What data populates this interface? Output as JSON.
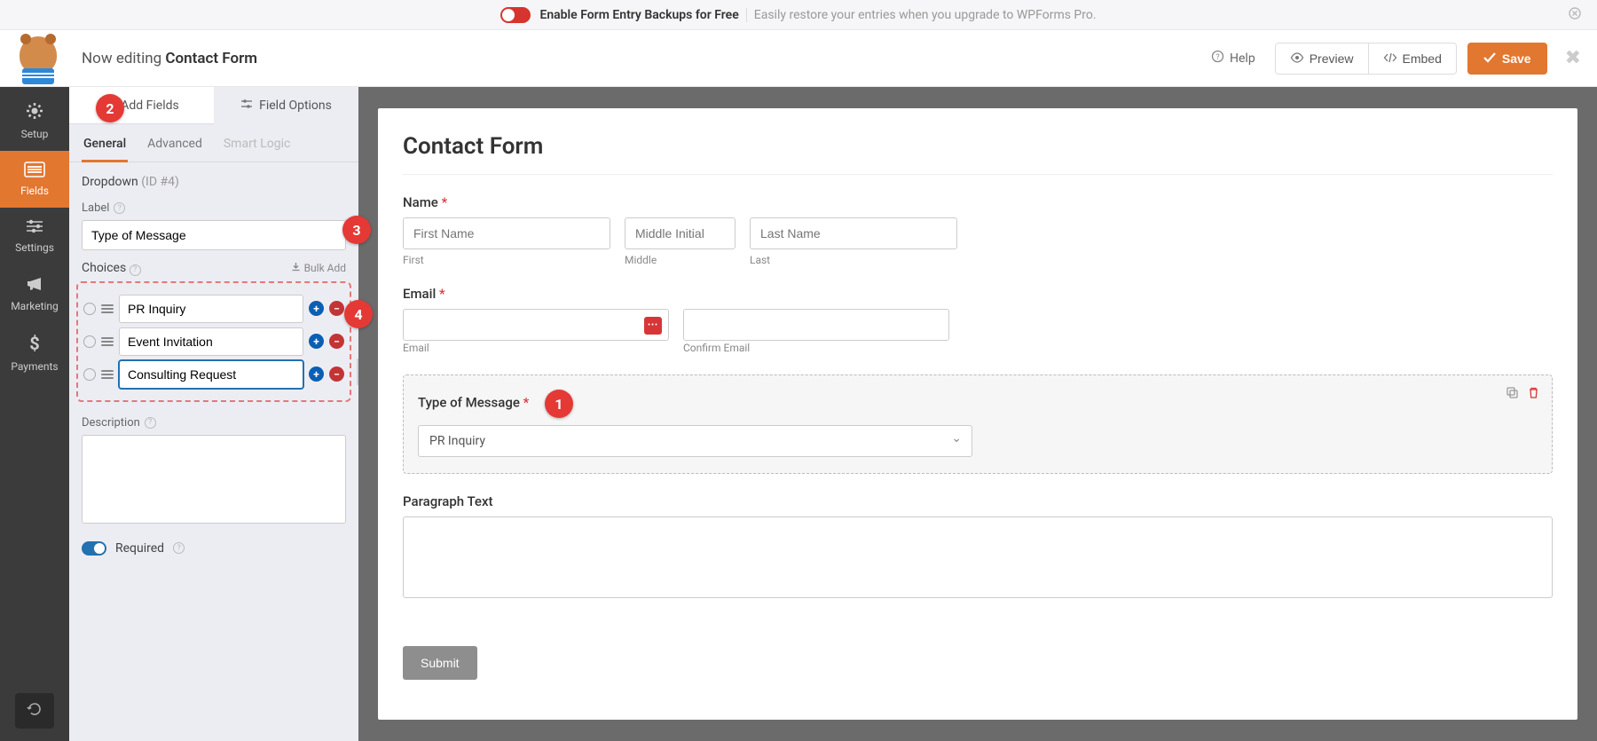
{
  "banner": {
    "bold_text": "Enable Form Entry Backups for Free",
    "light_text": "Easily restore your entries when you upgrade to WPForms Pro."
  },
  "header": {
    "editing_prefix": "Now editing ",
    "form_name": "Contact Form",
    "help": "Help",
    "preview": "Preview",
    "embed": "Embed",
    "save": "Save"
  },
  "nav": {
    "setup": "Setup",
    "fields": "Fields",
    "settings": "Settings",
    "marketing": "Marketing",
    "payments": "Payments"
  },
  "panel": {
    "tab_add": "Add Fields",
    "tab_options": "Field Options",
    "sub_general": "General",
    "sub_advanced": "Advanced",
    "sub_smart": "Smart Logic",
    "field_type": "Dropdown",
    "field_id": "(ID #4)",
    "label_label": "Label",
    "label_value": "Type of Message",
    "choices_label": "Choices",
    "bulk_add": "Bulk Add",
    "choice1": "PR Inquiry",
    "choice2": "Event Invitation",
    "choice3": "Consulting Request",
    "description_label": "Description",
    "required_label": "Required"
  },
  "callouts": {
    "c1": "1",
    "c2": "2",
    "c3": "3",
    "c4": "4"
  },
  "form": {
    "title": "Contact Form",
    "name_label": "Name",
    "first_ph": "First Name",
    "middle_ph": "Middle Initial",
    "last_ph": "Last Name",
    "first_sub": "First",
    "middle_sub": "Middle",
    "last_sub": "Last",
    "email_label": "Email",
    "email_sub": "Email",
    "confirm_sub": "Confirm Email",
    "type_label": "Type of Message",
    "type_selected": "PR Inquiry",
    "para_label": "Paragraph Text",
    "submit": "Submit"
  }
}
